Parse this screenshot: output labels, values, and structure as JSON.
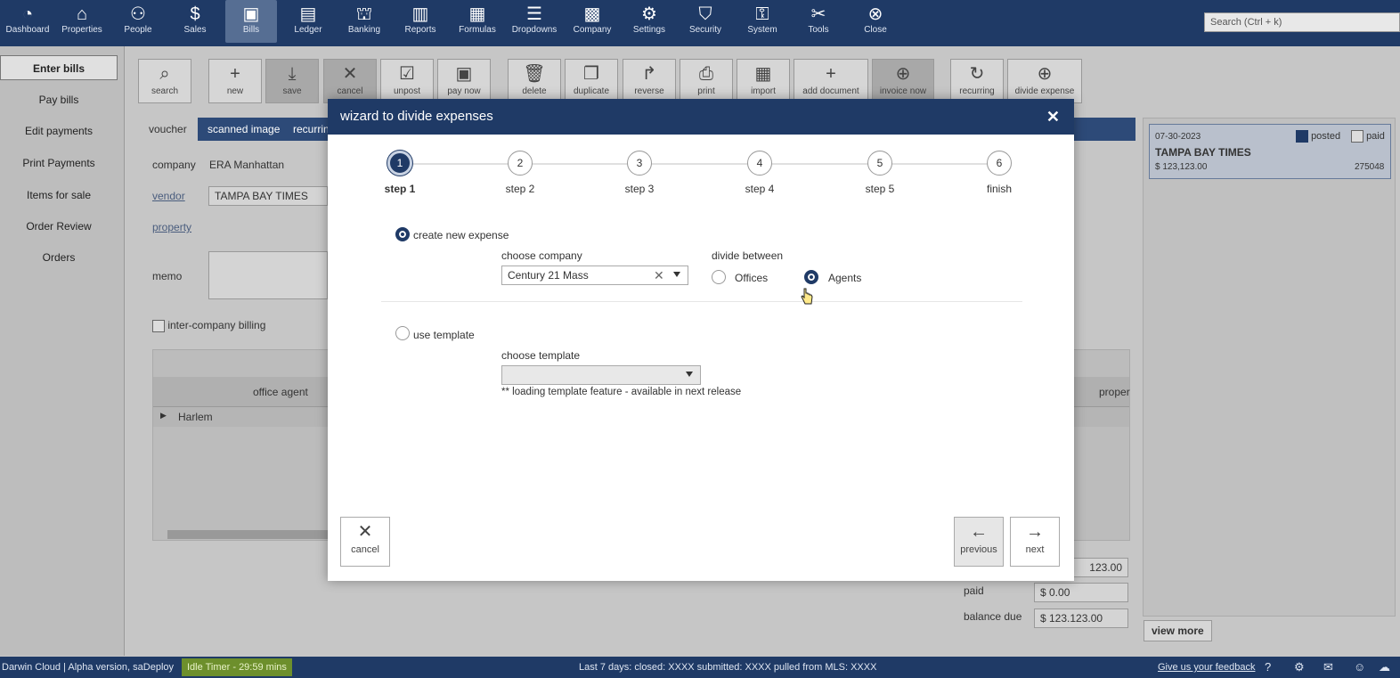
{
  "topnav": {
    "items": [
      {
        "label": "Dashboard",
        "icon": "dashboard-icon",
        "glyph": "◔"
      },
      {
        "label": "Properties",
        "icon": "home-icon",
        "glyph": "⌂"
      },
      {
        "label": "People",
        "icon": "people-icon",
        "glyph": "⚇"
      },
      {
        "label": "Sales",
        "icon": "dollar-icon",
        "glyph": "$"
      },
      {
        "label": "Bills",
        "icon": "bills-icon",
        "glyph": "▣"
      },
      {
        "label": "Ledger",
        "icon": "ledger-icon",
        "glyph": "▤"
      },
      {
        "label": "Banking",
        "icon": "bank-icon",
        "glyph": "⛫"
      },
      {
        "label": "Reports",
        "icon": "reports-icon",
        "glyph": "▥"
      },
      {
        "label": "Formulas",
        "icon": "calculator-icon",
        "glyph": "▦"
      },
      {
        "label": "Dropdowns",
        "icon": "menu-icon",
        "glyph": "☰"
      },
      {
        "label": "Company",
        "icon": "building-icon",
        "glyph": "▩"
      },
      {
        "label": "Settings",
        "icon": "gear-icon",
        "glyph": "⚙"
      },
      {
        "label": "Security",
        "icon": "shield-icon",
        "glyph": "⛉"
      },
      {
        "label": "System",
        "icon": "lock-icon",
        "glyph": "⚿"
      },
      {
        "label": "Tools",
        "icon": "tools-icon",
        "glyph": "✂"
      },
      {
        "label": "Close",
        "icon": "close-circle-icon",
        "glyph": "⊗"
      }
    ],
    "search_placeholder": "Search (Ctrl + k)"
  },
  "sidebar": {
    "items": [
      "Enter bills",
      "Pay bills",
      "Edit payments",
      "Print Payments",
      "Items for sale",
      "Order Review",
      "Orders"
    ]
  },
  "toolbar": {
    "buttons": [
      {
        "label": "search",
        "glyph": "⌕"
      },
      {
        "label": "new",
        "glyph": "+"
      },
      {
        "label": "save",
        "glyph": "⤓"
      },
      {
        "label": "cancel",
        "glyph": "✕"
      },
      {
        "label": "unpost",
        "glyph": "☑"
      },
      {
        "label": "pay now",
        "glyph": "▣"
      },
      {
        "label": "delete",
        "glyph": "🗑"
      },
      {
        "label": "duplicate",
        "glyph": "❐"
      },
      {
        "label": "reverse",
        "glyph": "↱"
      },
      {
        "label": "print",
        "glyph": "⎙"
      },
      {
        "label": "import",
        "glyph": "▦"
      },
      {
        "label": "add document",
        "glyph": "+"
      },
      {
        "label": "invoice now",
        "glyph": "⊕"
      },
      {
        "label": "recurring",
        "glyph": "↻"
      },
      {
        "label": "divide expense",
        "glyph": "⊕"
      }
    ]
  },
  "bg": {
    "tabs": [
      "voucher",
      "scanned image",
      "recurrin"
    ],
    "company_label": "company",
    "company_value": "ERA Manhattan",
    "vendor_label": "vendor",
    "vendor_value": "TAMPA BAY TIMES",
    "property_label": "property",
    "memo_label": "memo",
    "intercompany_label": "inter-company billing",
    "grid_col1": "office agent",
    "grid_col2": "proper",
    "grid_row1": "Harlem",
    "total_value": "123.00",
    "paid_label": "paid",
    "paid_value": "$ 0.00",
    "balance_label": "balance due",
    "balance_value": "$ 123.123.00",
    "card_date": "07-30-2023",
    "card_posted": "posted",
    "card_paid": "paid",
    "card_vendor": "TAMPA BAY TIMES",
    "card_amount": "$ 123,123.00",
    "card_id": "275048",
    "view_more": "view more"
  },
  "modal": {
    "title": "wizard to divide expenses",
    "close_glyph": "✕",
    "steps": [
      {
        "num": "1",
        "label": "step 1"
      },
      {
        "num": "2",
        "label": "step 2"
      },
      {
        "num": "3",
        "label": "step 3"
      },
      {
        "num": "4",
        "label": "step 4"
      },
      {
        "num": "5",
        "label": "step 5"
      },
      {
        "num": "6",
        "label": "finish"
      }
    ],
    "option_new": "create new expense",
    "choose_company_label": "choose company",
    "company_value": "Century 21 Mass",
    "divide_between_label": "divide between",
    "divide_offices": "Offices",
    "divide_agents": "Agents",
    "option_template": "use template",
    "choose_template_label": "choose template",
    "template_note": "** loading template feature - available in next release",
    "cancel_label": "cancel",
    "previous_label": "previous",
    "next_label": "next"
  },
  "statusbar": {
    "left": "Darwin Cloud | Alpha version, saDeploy",
    "idle": "Idle Timer - 29:59 mins",
    "center": "Last 7 days: closed: XXXX submitted: XXXX pulled from MLS: XXXX",
    "feedback": "Give us your feedback"
  },
  "colors": {
    "nav": "#1f3a66",
    "accent": "#1f3a66",
    "idle": "#6d8f2c"
  }
}
